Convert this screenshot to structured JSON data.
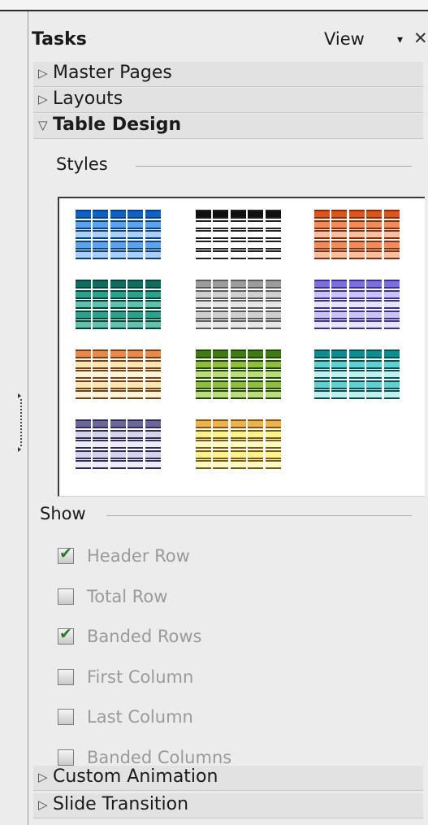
{
  "panel": {
    "title": "Tasks",
    "view_label": "View",
    "view_arrow": "▾",
    "close_glyph": "✕"
  },
  "decks": [
    {
      "label": "Master Pages",
      "open": false,
      "icon": "triangle-right-icon"
    },
    {
      "label": "Layouts",
      "open": false,
      "icon": "triangle-right-icon"
    },
    {
      "label": "Table Design",
      "open": true,
      "icon": "triangle-down-icon"
    },
    {
      "label": "Custom Animation",
      "open": false,
      "icon": "triangle-right-icon"
    },
    {
      "label": "Slide Transition",
      "open": false,
      "icon": "triangle-right-icon"
    }
  ],
  "table_design": {
    "styles_label": "Styles",
    "show_label": "Show",
    "styles": [
      {
        "id": "style-blue",
        "header": "#0b63c7",
        "band": "#5aa3f0",
        "light": "#a9d1f7",
        "line": "#0a3f8a"
      },
      {
        "id": "style-black",
        "header": "#101010",
        "band": "#ffffff",
        "light": "#ffffff",
        "line": "#202020"
      },
      {
        "id": "style-orange",
        "header": "#e0531a",
        "band": "#f38a5a",
        "light": "#f9bf9f",
        "line": "#8a2c06"
      },
      {
        "id": "style-teal",
        "header": "#0b6e5e",
        "band": "#2aa38c",
        "light": "#5fc2ae",
        "line": "#074236"
      },
      {
        "id": "style-gray",
        "header": "#9c9c9c",
        "band": "#cfcfcf",
        "light": "#e6e6e6",
        "line": "#5a5a5a"
      },
      {
        "id": "style-lavender",
        "header": "#7a6fe0",
        "band": "#c9c4f5",
        "light": "#e6e3fb",
        "line": "#3a2f9a"
      },
      {
        "id": "style-peach",
        "header": "#e98a4a",
        "band": "#fde6b0",
        "light": "#fff4d6",
        "line": "#7a3d10"
      },
      {
        "id": "style-green",
        "header": "#3f7a12",
        "band": "#8fbf3a",
        "light": "#bcdc7a",
        "line": "#1f4a05"
      },
      {
        "id": "style-cyan",
        "header": "#0a8e92",
        "band": "#5fd0d2",
        "light": "#bff0f0",
        "line": "#044f52"
      },
      {
        "id": "style-slate",
        "header": "#6b679a",
        "band": "#d4d3ea",
        "light": "#ecebf6",
        "line": "#2e2b5a"
      },
      {
        "id": "style-yellow",
        "header": "#f0b04a",
        "band": "#fff38a",
        "light": "#fffac2",
        "line": "#7a5a10"
      }
    ],
    "checkboxes": [
      {
        "label": "Header Row",
        "checked": true
      },
      {
        "label": "Total Row",
        "checked": false
      },
      {
        "label": "Banded Rows",
        "checked": true
      },
      {
        "label": "First Column",
        "checked": false
      },
      {
        "label": "Last Column",
        "checked": false
      },
      {
        "label": "Banded Columns",
        "checked": false
      }
    ]
  }
}
